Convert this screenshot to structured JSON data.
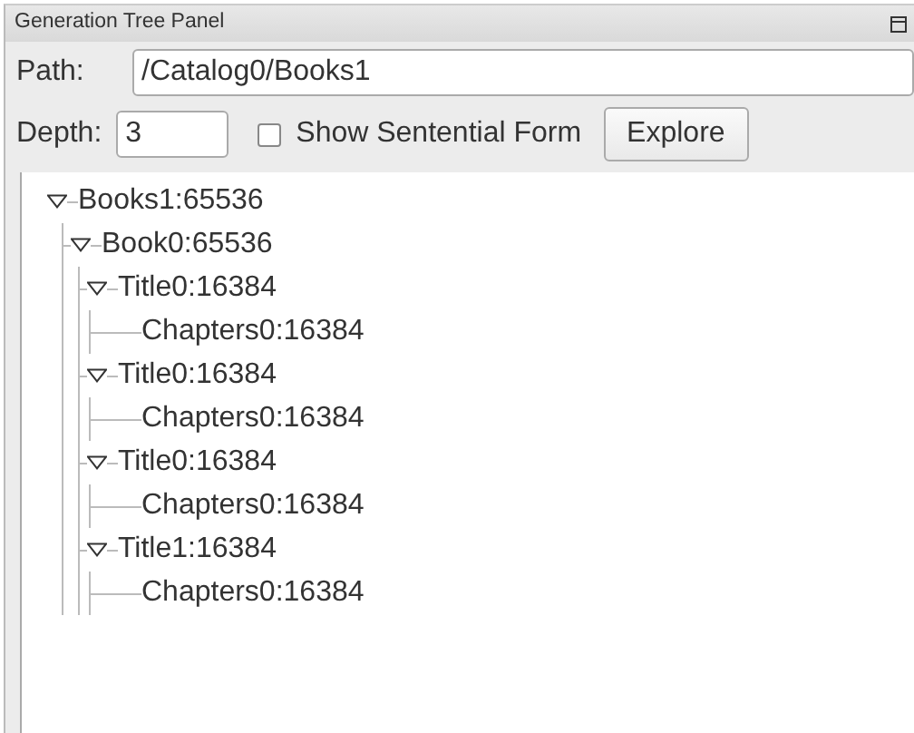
{
  "window": {
    "title": "Generation Tree Panel"
  },
  "path": {
    "label": "Path:",
    "value": "/Catalog0/Books1"
  },
  "depth": {
    "label": "Depth:",
    "value": "3"
  },
  "sentential": {
    "label": "Show Sentential Form",
    "checked": false
  },
  "explore_button": "Explore",
  "tree": [
    {
      "label": "Books1:65536",
      "expanded": true,
      "children": [
        {
          "label": "Book0:65536",
          "expanded": true,
          "children": [
            {
              "label": "Title0:16384",
              "expanded": true,
              "children": [
                {
                  "label": "Chapters0:16384"
                }
              ]
            },
            {
              "label": "Title0:16384",
              "expanded": true,
              "children": [
                {
                  "label": "Chapters0:16384"
                }
              ]
            },
            {
              "label": "Title0:16384",
              "expanded": true,
              "children": [
                {
                  "label": "Chapters0:16384"
                }
              ]
            },
            {
              "label": "Title1:16384",
              "expanded": true,
              "children": [
                {
                  "label": "Chapters0:16384"
                }
              ]
            }
          ]
        }
      ]
    }
  ]
}
